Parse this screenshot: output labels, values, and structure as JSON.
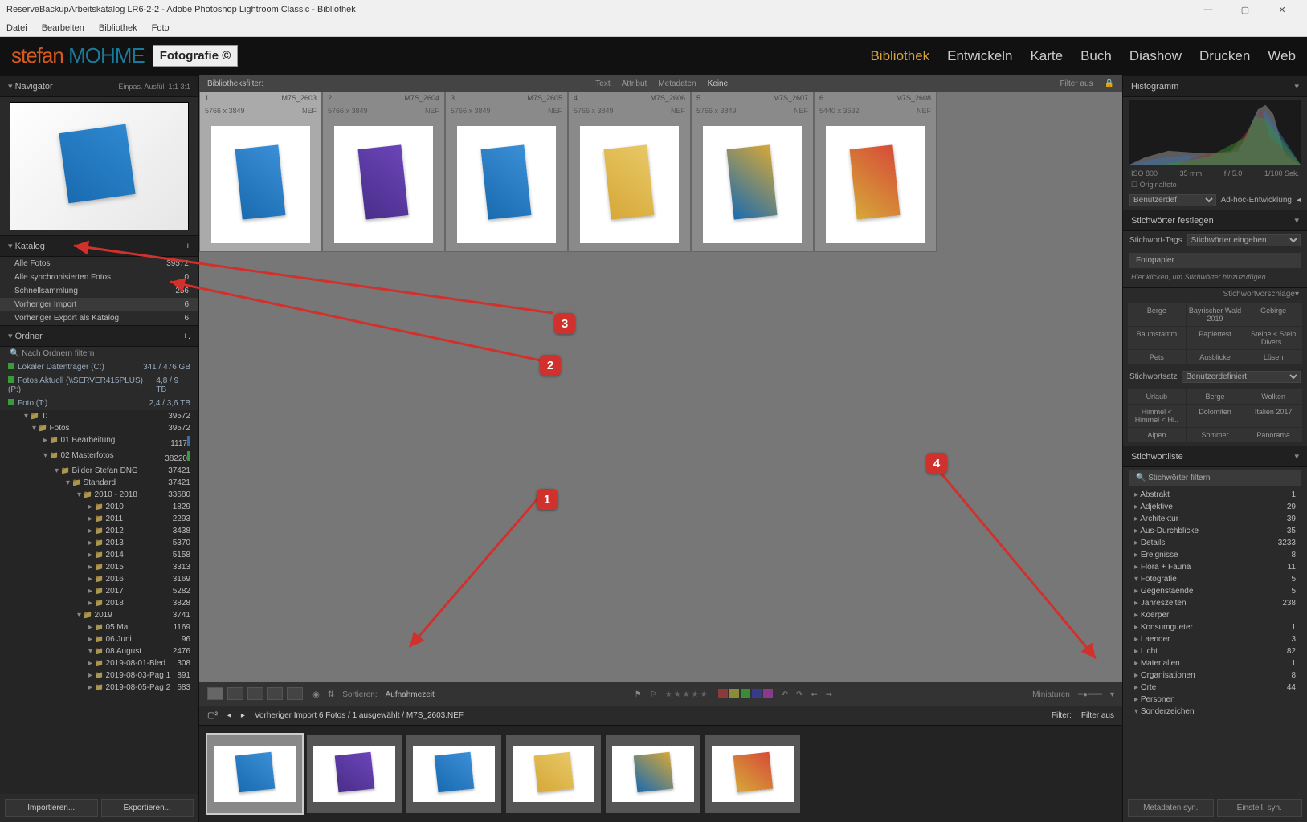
{
  "window": {
    "title": "ReserveBackupArbeitskatalog LR6-2-2 - Adobe Photoshop Lightroom Classic - Bibliothek"
  },
  "menubar": [
    "Datei",
    "Bearbeiten",
    "Bibliothek",
    "Foto"
  ],
  "logo": {
    "line1a": "stefan",
    "line1b": "MOHME",
    "badge": "Fotografie ©"
  },
  "modules": [
    "Bibliothek",
    "Entwickeln",
    "Karte",
    "Buch",
    "Diashow",
    "Drucken",
    "Web"
  ],
  "active_module": "Bibliothek",
  "navigator": {
    "title": "Navigator",
    "modes": [
      "Einpas.",
      "Ausfül.",
      "1:1",
      "3:1"
    ]
  },
  "catalog": {
    "title": "Katalog",
    "rows": [
      {
        "label": "Alle Fotos",
        "count": "39572"
      },
      {
        "label": "Alle synchronisierten Fotos",
        "count": "0"
      },
      {
        "label": "Schnellsammlung",
        "count": "256"
      },
      {
        "label": "Vorheriger Import",
        "count": "6",
        "selected": true
      },
      {
        "label": "Vorheriger Export als Katalog",
        "count": "6"
      }
    ]
  },
  "folders": {
    "title": "Ordner",
    "filter": "Nach Ordnern filtern",
    "drives": [
      {
        "label": "Lokaler Datenträger (C:)",
        "meta": "341 / 476 GB"
      },
      {
        "label": "Fotos Aktuell (\\\\SERVER415PLUS) (P:)",
        "meta": "4,8 / 9 TB"
      },
      {
        "label": "Foto (T:)",
        "meta": "2,4 / 3,6 TB"
      }
    ],
    "tree": [
      {
        "name": "T:",
        "count": "39572",
        "lvl": 0,
        "open": true
      },
      {
        "name": "Fotos",
        "count": "39572",
        "lvl": 1,
        "open": true
      },
      {
        "name": "01 Bearbeitung",
        "count": "1117",
        "lvl": 2,
        "bar": "blue"
      },
      {
        "name": "02 Masterfotos",
        "count": "38220",
        "lvl": 2,
        "open": true,
        "bar": "green"
      },
      {
        "name": "Bilder Stefan DNG",
        "count": "37421",
        "lvl": 3,
        "open": true
      },
      {
        "name": "Standard",
        "count": "37421",
        "lvl": 4,
        "open": true
      },
      {
        "name": "2010 - 2018",
        "count": "33680",
        "lvl": 5,
        "open": true
      },
      {
        "name": "2010",
        "count": "1829",
        "lvl": 6
      },
      {
        "name": "2011",
        "count": "2293",
        "lvl": 6
      },
      {
        "name": "2012",
        "count": "3438",
        "lvl": 6
      },
      {
        "name": "2013",
        "count": "5370",
        "lvl": 6
      },
      {
        "name": "2014",
        "count": "5158",
        "lvl": 6
      },
      {
        "name": "2015",
        "count": "3313",
        "lvl": 6
      },
      {
        "name": "2016",
        "count": "3169",
        "lvl": 6
      },
      {
        "name": "2017",
        "count": "5282",
        "lvl": 6
      },
      {
        "name": "2018",
        "count": "3828",
        "lvl": 6
      },
      {
        "name": "2019",
        "count": "3741",
        "lvl": 5,
        "open": true
      },
      {
        "name": "05 Mai",
        "count": "1169",
        "lvl": 6
      },
      {
        "name": "06 Juni",
        "count": "96",
        "lvl": 6
      },
      {
        "name": "08 August",
        "count": "2476",
        "lvl": 6,
        "open": true
      },
      {
        "name": "2019-08-01-Bled",
        "count": "308",
        "lvl": 6
      },
      {
        "name": "2019-08-03-Pag 1",
        "count": "891",
        "lvl": 6
      },
      {
        "name": "2019-08-05-Pag 2",
        "count": "683",
        "lvl": 6
      }
    ],
    "buttons": {
      "import": "Importieren...",
      "export": "Exportieren..."
    }
  },
  "filter_bar": {
    "label": "Bibliotheksfilter:",
    "items": [
      "Text",
      "Attribut",
      "Metadaten",
      "Keine"
    ],
    "right": "Filter aus"
  },
  "grid": {
    "cells": [
      {
        "n": "1",
        "file": "M7S_2603",
        "dim": "5766 x 3849",
        "fmt": "NEF",
        "sel": true,
        "t": "t1"
      },
      {
        "n": "2",
        "file": "M7S_2604",
        "dim": "5766 x 3849",
        "fmt": "NEF",
        "t": "t2"
      },
      {
        "n": "3",
        "file": "M7S_2605",
        "dim": "5766 x 3849",
        "fmt": "NEF",
        "t": "t3"
      },
      {
        "n": "4",
        "file": "M7S_2606",
        "dim": "5766 x 3849",
        "fmt": "NEF",
        "t": "t4"
      },
      {
        "n": "5",
        "file": "M7S_2607",
        "dim": "5766 x 3849",
        "fmt": "NEF",
        "t": "t5"
      },
      {
        "n": "6",
        "file": "M7S_2608",
        "dim": "5440 x 3632",
        "fmt": "NEF",
        "t": "t6"
      }
    ]
  },
  "toolbar_center": {
    "sort_label": "Sortieren:",
    "sort_value": "Aufnahmezeit",
    "right_label": "Miniaturen"
  },
  "status": {
    "text": "Vorheriger Import   6 Fotos / 1 ausgewählt / M7S_2603.NEF",
    "filter": "Filter:",
    "filter_val": "Filter aus"
  },
  "histogram": {
    "title": "Histogramm",
    "labels": [
      "ISO 800",
      "35 mm",
      "f / 5.0",
      "1/100 Sek."
    ],
    "orig": "Originalfoto"
  },
  "right_panels": {
    "dev_select": "Benutzerdef.",
    "adhoc": "Ad-hoc-Entwicklung",
    "kw_set": "Stichwörter festlegen",
    "kw_tags": "Stichwort-Tags",
    "kw_tags_mode": "Stichwörter eingeben",
    "kw_value": "Fotopapier",
    "kw_hint": "Hier klicken, um Stichwörter hinzuzufügen",
    "kw_sugg": "Stichwortvorschläge",
    "sugg": [
      "Berge",
      "Bayrischer Wald 2019",
      "Gebirge",
      "Baumstamm",
      "Papiertest",
      "Steine < Stein Divers..",
      "Pets",
      "Ausblicke",
      "Lüsen"
    ],
    "kw_set2": "Stichwortsatz",
    "kw_set2_val": "Benutzerdefiniert",
    "set2": [
      "Urlaub",
      "Berge",
      "Wolken",
      "Himmel < Himmel < Hi..",
      "Dolomiten",
      "Italien 2017",
      "Alpen",
      "Sommer",
      "Panorama"
    ],
    "kw_list": "Stichwortliste",
    "kw_filter": "Stichwörter filtern",
    "keywords": [
      {
        "name": "Abstrakt",
        "count": "1"
      },
      {
        "name": "Adjektive",
        "count": "29"
      },
      {
        "name": "Architektur",
        "count": "39"
      },
      {
        "name": "Aus-Durchblicke",
        "count": "35"
      },
      {
        "name": "Details",
        "count": "3233"
      },
      {
        "name": "Ereignisse",
        "count": "8"
      },
      {
        "name": "Flora + Fauna",
        "count": "11"
      },
      {
        "name": "Fotografie",
        "count": "5",
        "open": true
      },
      {
        "name": "Gegenstaende",
        "count": "5"
      },
      {
        "name": "Jahreszeiten",
        "count": "238"
      },
      {
        "name": "Koerper",
        "count": ""
      },
      {
        "name": "Konsumgueter",
        "count": "1"
      },
      {
        "name": "Laender",
        "count": "3"
      },
      {
        "name": "Licht",
        "count": "82"
      },
      {
        "name": "Materialien",
        "count": "1"
      },
      {
        "name": "Organisationen",
        "count": "8"
      },
      {
        "name": "Orte",
        "count": "44"
      },
      {
        "name": "Personen",
        "count": ""
      },
      {
        "name": "Sonderzeichen",
        "count": "",
        "open": true
      }
    ],
    "btn_sync": "Metadaten syn.",
    "btn_sync2": "Einstell. syn."
  },
  "annotations": [
    "1",
    "2",
    "3",
    "4"
  ]
}
